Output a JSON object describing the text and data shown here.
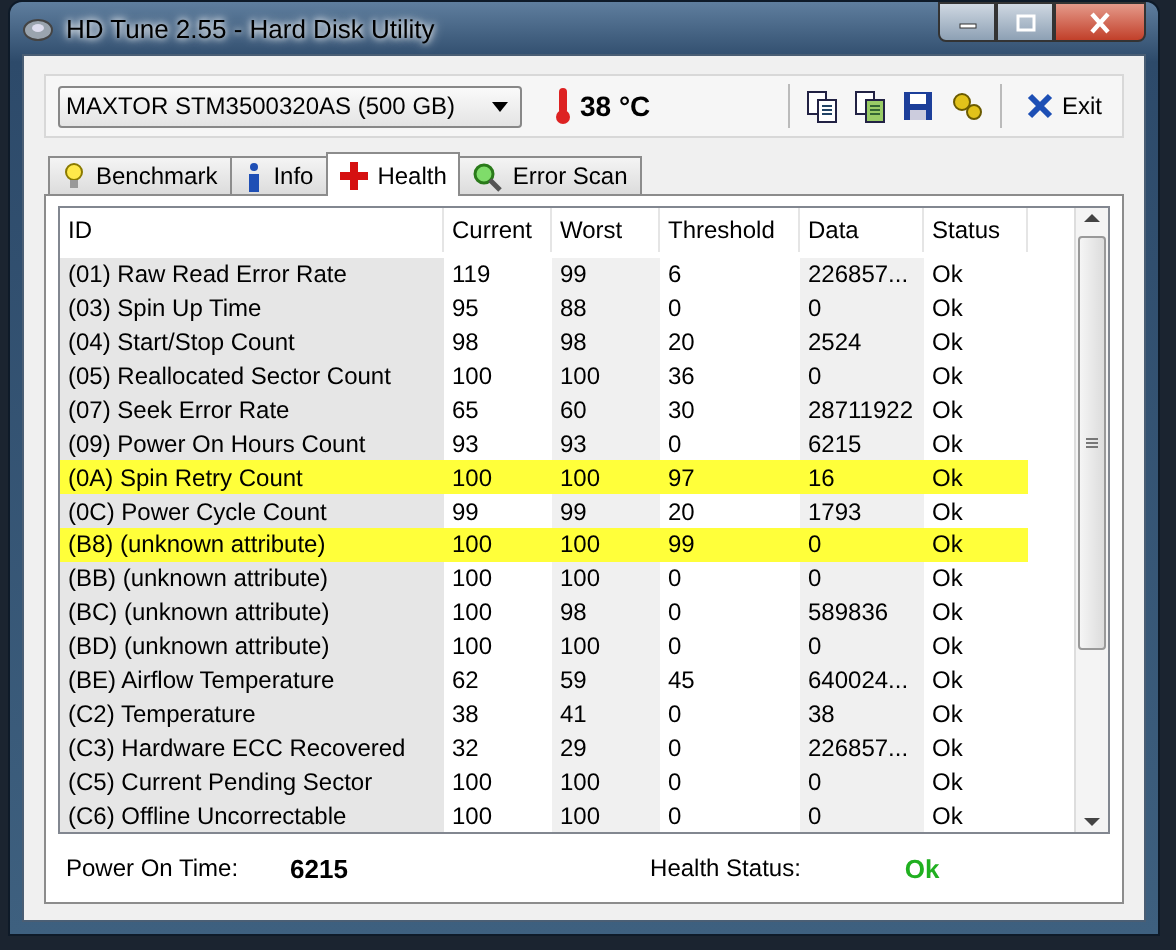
{
  "window": {
    "title": "HD Tune 2.55 - Hard Disk Utility"
  },
  "toolbar": {
    "drive": "MAXTOR STM3500320AS (500 GB)",
    "temperature": "38 °C",
    "exit": "Exit"
  },
  "tabs": [
    {
      "label": "Benchmark",
      "selected": false
    },
    {
      "label": "Info",
      "selected": false
    },
    {
      "label": "Health",
      "selected": true
    },
    {
      "label": "Error Scan",
      "selected": false
    }
  ],
  "table": {
    "columns": [
      "ID",
      "Current",
      "Worst",
      "Threshold",
      "Data",
      "Status"
    ],
    "rows": [
      {
        "cells": [
          "(01) Raw Read Error Rate",
          "119",
          "99",
          "6",
          "226857...",
          "Ok"
        ],
        "highlighted": false
      },
      {
        "cells": [
          "(03) Spin Up Time",
          "95",
          "88",
          "0",
          "0",
          "Ok"
        ],
        "highlighted": false
      },
      {
        "cells": [
          "(04) Start/Stop Count",
          "98",
          "98",
          "20",
          "2524",
          "Ok"
        ],
        "highlighted": false
      },
      {
        "cells": [
          "(05) Reallocated Sector Count",
          "100",
          "100",
          "36",
          "0",
          "Ok"
        ],
        "highlighted": false
      },
      {
        "cells": [
          "(07) Seek Error Rate",
          "65",
          "60",
          "30",
          "28711922",
          "Ok"
        ],
        "highlighted": false
      },
      {
        "cells": [
          "(09) Power On Hours Count",
          "93",
          "93",
          "0",
          "6215",
          "Ok"
        ],
        "highlighted": false
      },
      {
        "cells": [
          "(0A) Spin Retry Count",
          "100",
          "100",
          "97",
          "16",
          "Ok"
        ],
        "highlighted": true
      },
      {
        "cells": [
          "(0C) Power Cycle Count",
          "99",
          "99",
          "20",
          "1793",
          "Ok"
        ],
        "highlighted": false
      },
      {
        "cells": [
          "(B8) (unknown attribute)",
          "100",
          "100",
          "99",
          "0",
          "Ok"
        ],
        "highlighted": true
      },
      {
        "cells": [
          "(BB) (unknown attribute)",
          "100",
          "100",
          "0",
          "0",
          "Ok"
        ],
        "highlighted": false
      },
      {
        "cells": [
          "(BC) (unknown attribute)",
          "100",
          "98",
          "0",
          "589836",
          "Ok"
        ],
        "highlighted": false
      },
      {
        "cells": [
          "(BD) (unknown attribute)",
          "100",
          "100",
          "0",
          "0",
          "Ok"
        ],
        "highlighted": false
      },
      {
        "cells": [
          "(BE) Airflow Temperature",
          "62",
          "59",
          "45",
          "640024...",
          "Ok"
        ],
        "highlighted": false
      },
      {
        "cells": [
          "(C2) Temperature",
          "38",
          "41",
          "0",
          "38",
          "Ok"
        ],
        "highlighted": false
      },
      {
        "cells": [
          "(C3) Hardware ECC Recovered",
          "32",
          "29",
          "0",
          "226857...",
          "Ok"
        ],
        "highlighted": false
      },
      {
        "cells": [
          "(C5) Current Pending Sector",
          "100",
          "100",
          "0",
          "0",
          "Ok"
        ],
        "highlighted": false
      },
      {
        "cells": [
          "(C6) Offline Uncorrectable",
          "100",
          "100",
          "0",
          "0",
          "Ok"
        ],
        "highlighted": false
      }
    ]
  },
  "status_bar": {
    "power_on_label": "Power On Time:",
    "power_on_value": "6215",
    "health_label": "Health Status:",
    "health_value": "Ok"
  }
}
